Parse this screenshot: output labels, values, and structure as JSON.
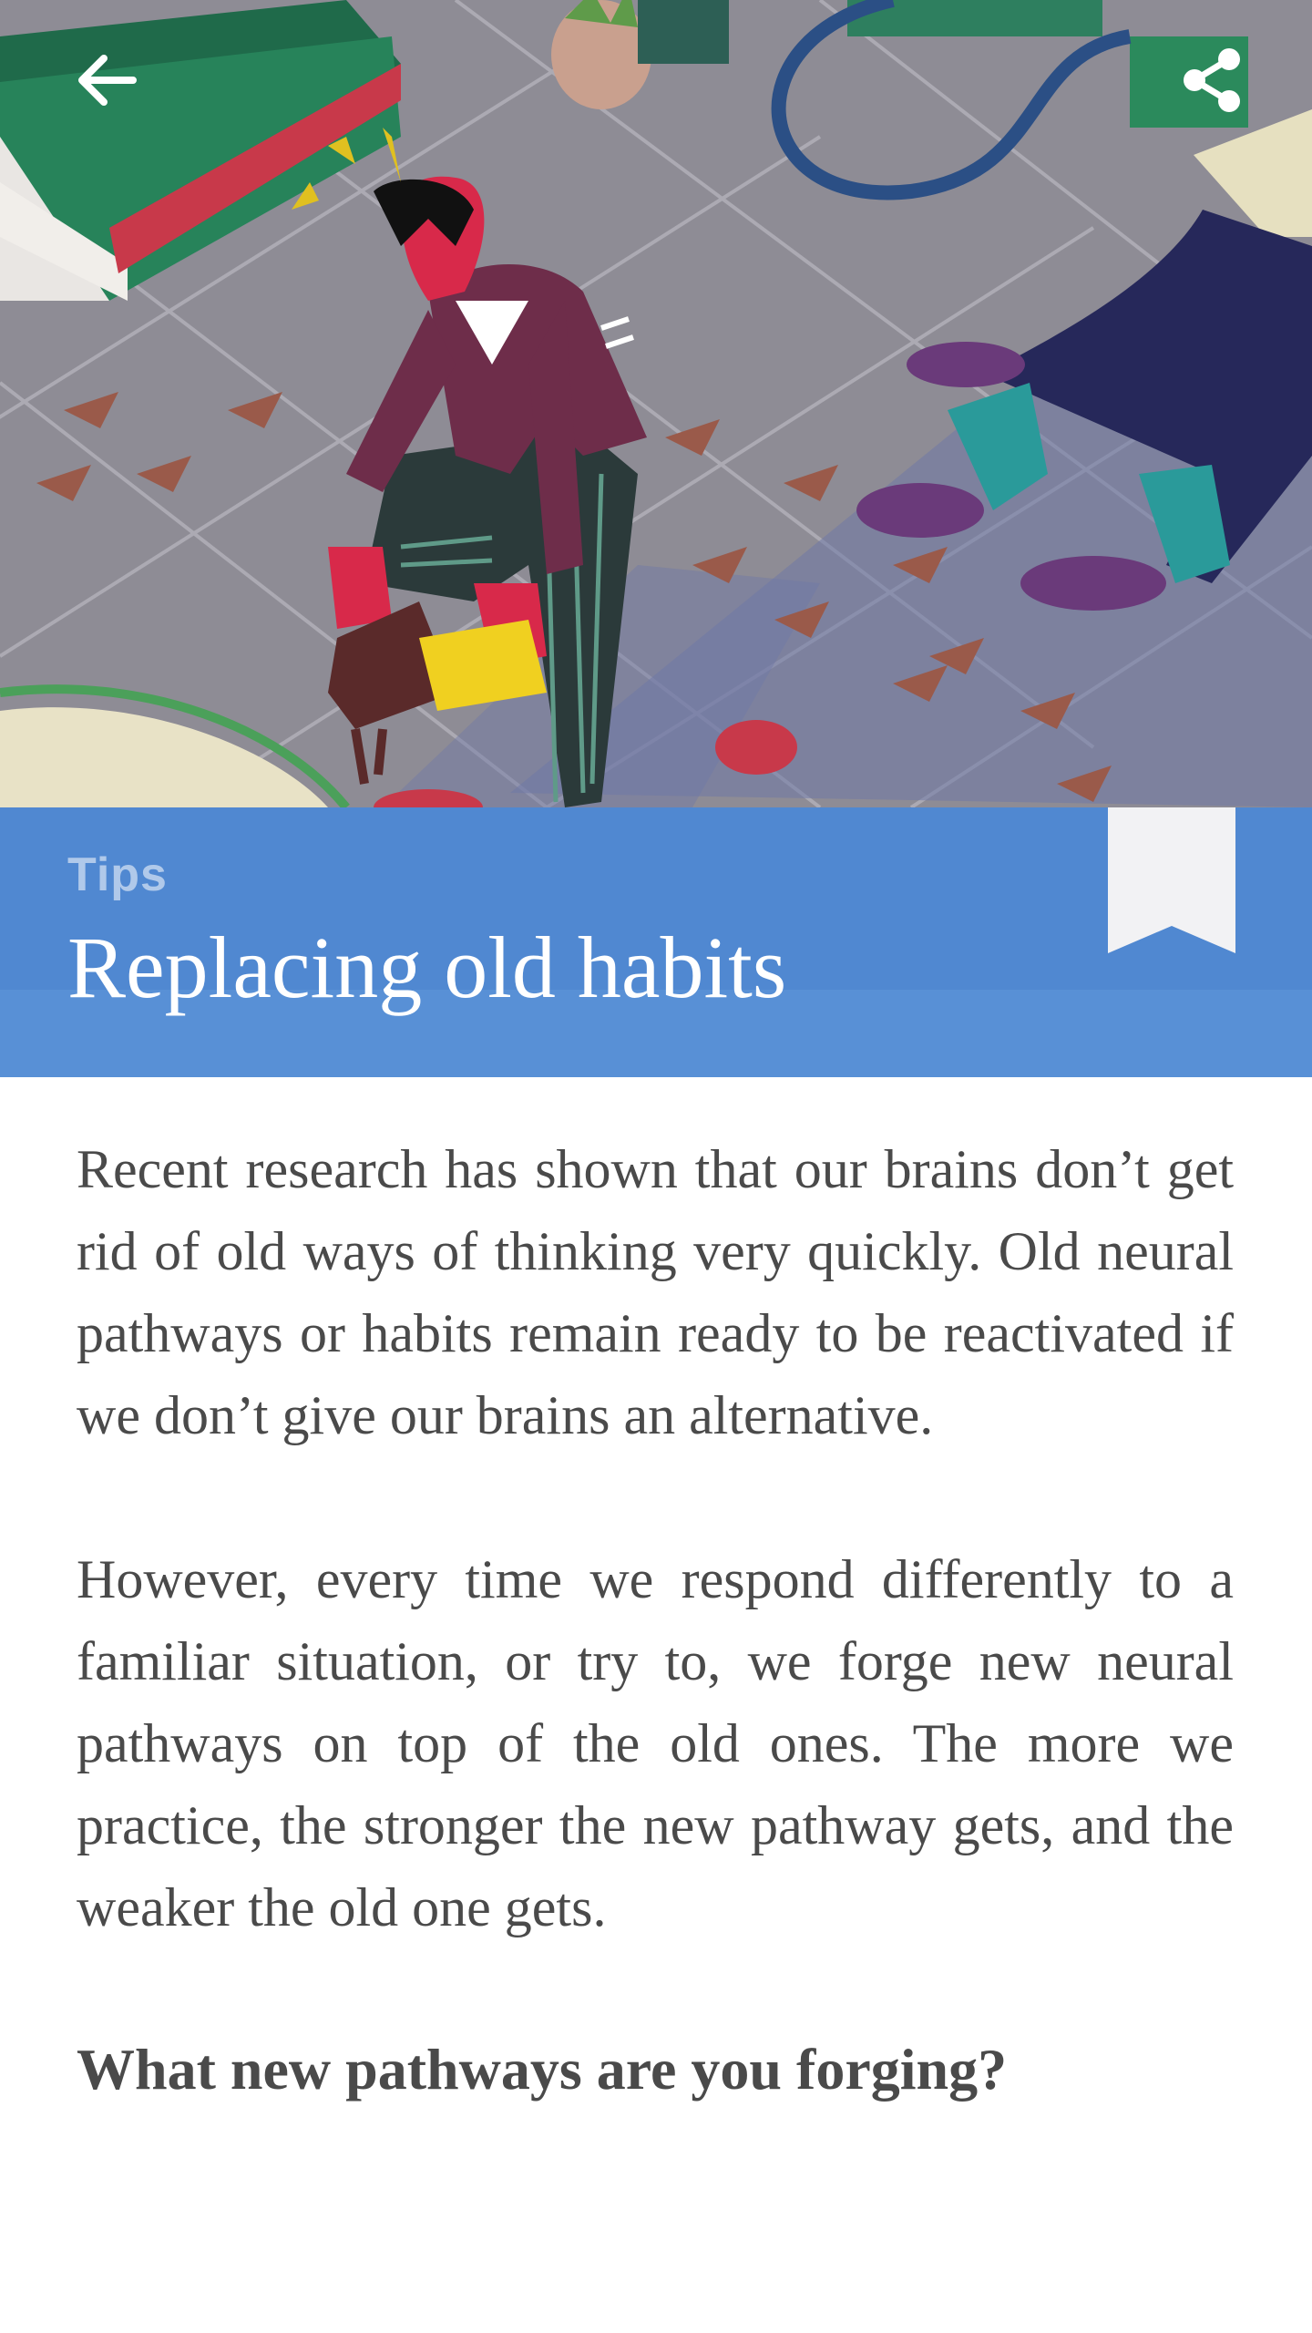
{
  "toolbar": {
    "back_icon": "arrow-left-icon",
    "share_icon": "share-icon"
  },
  "article": {
    "category": "Tips",
    "title": "Replacing old habits",
    "paragraphs": [
      "Recent research has shown that our brains don’t get rid of old ways of thinking very quickly. Old neural pathways or habits remain ready to be reactivated if we don’t give our brains an alternative.",
      "However, every time we respond differently to a familiar situation, or try to, we forge new neural pathways on top of the old ones. The more we practice, the stronger the new pathway gets, and the weaker the old one gets."
    ],
    "question": "What new pathways are you forging?",
    "bookmark_icon": "bookmark-icon"
  },
  "colors": {
    "accent": "#5890d6",
    "body_text": "#4a4a4a",
    "background": "#ffffff"
  }
}
